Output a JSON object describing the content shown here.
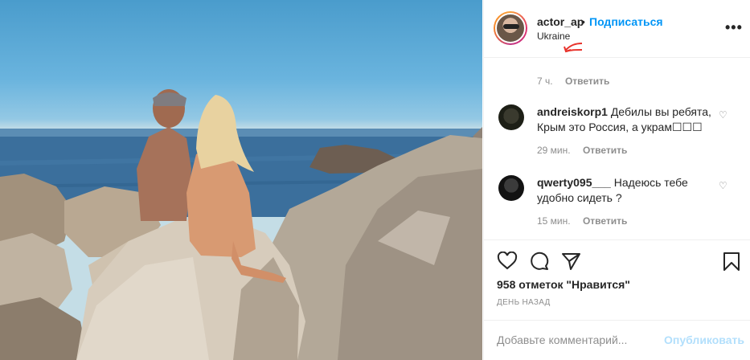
{
  "post": {
    "photo_alt_icon": "beach-photo"
  },
  "header": {
    "username": "actor_ap",
    "dot": "•",
    "follow_label": "Подписаться",
    "location": "Ukraine",
    "more_label": "•••"
  },
  "comments": [
    {
      "time": "7 ч.",
      "reply_label": "Ответить"
    },
    {
      "username": "andreiskorp1",
      "text_line1": "Дебилы вы ребята,",
      "text_line2": "Крым это Россия, а украм☐☐☐",
      "time": "29 мин.",
      "reply_label": "Ответить"
    },
    {
      "username": "qwerty095___",
      "text_line1": "Надеюсь тебе",
      "text_line2": "удобно сидеть ?",
      "time": "15 мин.",
      "reply_label": "Ответить"
    }
  ],
  "actions": {
    "likes": "958 отметок \"Нравится\"",
    "date": "ДЕНЬ НАЗАД"
  },
  "add_comment": {
    "placeholder": "Добавьте комментарий...",
    "publish_label": "Опубликовать"
  },
  "colors": {
    "link": "#0095f6",
    "muted": "#8e8e8e",
    "publish_disabled": "#b2dffc",
    "annotation": "#e8322b"
  }
}
